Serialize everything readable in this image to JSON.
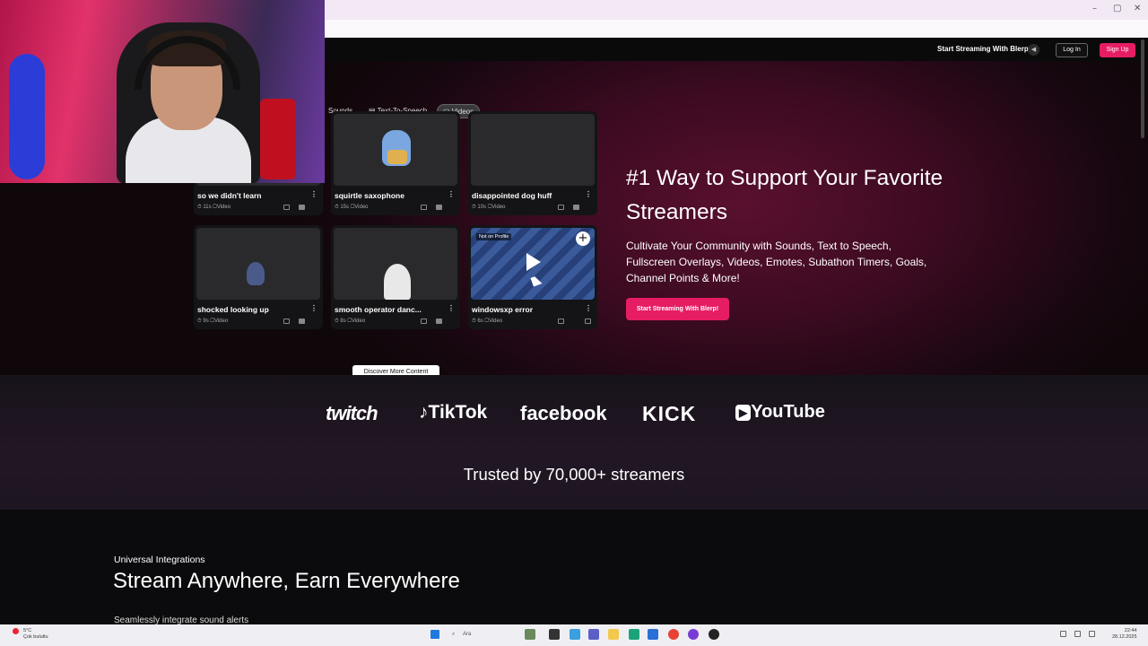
{
  "browser": {
    "window_controls": [
      "–",
      "▢",
      "✕"
    ],
    "toolbar_icons": [
      "screen-icon",
      "translate-icon",
      "star-icon",
      "extension-icon",
      "puzzle-icon"
    ]
  },
  "nav": {
    "cta": "Start Streaming With Blerp!",
    "login": "Log In",
    "signup": "Sign Up"
  },
  "filters": {
    "sounds": "Sounds",
    "tts": "Text-To-Speech",
    "videos": "Videos"
  },
  "cards": [
    {
      "title": "so we didn't learn",
      "duration": "11s",
      "type": "Video"
    },
    {
      "title": "squirtle saxophone",
      "duration": "15s",
      "type": "Video"
    },
    {
      "title": "disappointed dog huff",
      "duration": "10s",
      "type": "Video"
    },
    {
      "title": "shocked looking up",
      "duration": "9s",
      "type": "Video"
    },
    {
      "title": "smooth operator danc...",
      "duration": "8s",
      "type": "Video"
    },
    {
      "title": "windowsxp error",
      "duration": "6s",
      "type": "Video",
      "badge": "Not on Profile"
    }
  ],
  "discover": "Discover More Content",
  "hero": {
    "title": "#1 Way to Support Your Favorite Streamers",
    "description": "Cultivate Your Community with Sounds, Text to Speech, Fullscreen Overlays, Videos, Emotes, Subathon Timers, Goals, Channel Points & More!",
    "cta": "Start Streaming With Blerp!"
  },
  "platforms": [
    "twitch",
    "TikTok",
    "facebook",
    "KICK",
    "YouTube"
  ],
  "trusted": "Trusted by 70,000+ streamers",
  "integrations": {
    "label": "Universal Integrations",
    "title": "Stream Anywhere, Earn Everywhere",
    "subtitle": "Seamlessly integrate sound alerts"
  },
  "taskbar": {
    "weather_temp": "5°C",
    "weather_desc": "Çok bulutlu",
    "search_placeholder": "Ara",
    "time": "22:44",
    "date": "28.12.2025"
  },
  "colors": {
    "accent": "#e61d63",
    "hero_bg": "#3a0a20"
  }
}
